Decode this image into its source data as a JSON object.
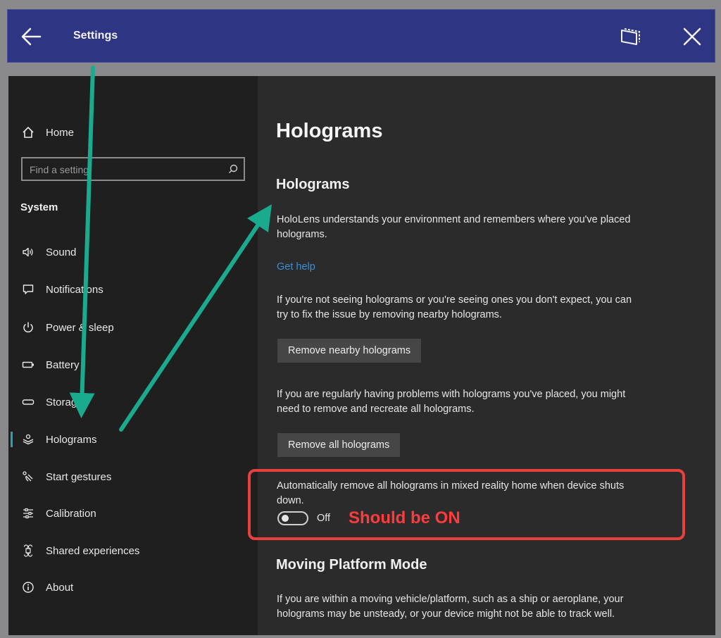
{
  "titlebar": {
    "title": "Settings",
    "back_icon": "arrow-left-icon",
    "snap_icon": "window-snap-icon",
    "close_icon": "close-icon"
  },
  "sidebar": {
    "home_label": "Home",
    "search": {
      "placeholder": "Find a setting"
    },
    "section_label": "System",
    "items": [
      {
        "label": "Sound",
        "icon": "speaker-icon"
      },
      {
        "label": "Notifications",
        "icon": "notification-icon"
      },
      {
        "label": "Power & sleep",
        "icon": "power-icon"
      },
      {
        "label": "Battery",
        "icon": "battery-icon"
      },
      {
        "label": "Storage",
        "icon": "storage-icon"
      },
      {
        "label": "Holograms",
        "icon": "holograms-icon",
        "selected": true
      },
      {
        "label": "Start gestures",
        "icon": "gesture-icon"
      },
      {
        "label": "Calibration",
        "icon": "sliders-icon"
      },
      {
        "label": "Shared experiences",
        "icon": "command-icon"
      },
      {
        "label": "About",
        "icon": "info-icon"
      }
    ],
    "accent_color": "#27a3b0"
  },
  "content": {
    "page_title": "Holograms",
    "section_title": "Holograms",
    "intro": "HoloLens understands your environment and remembers where you've placed holograms.",
    "help_link": "Get help",
    "nearby_desc": "If you're not seeing holograms or you're seeing ones you don't expect, you can try to fix the issue by removing nearby holograms.",
    "nearby_button": "Remove nearby holograms",
    "all_desc": "If you are regularly having problems with holograms you've placed, you might need to remove and recreate all holograms.",
    "all_button": "Remove all holograms",
    "auto_desc": "Automatically remove all holograms in mixed reality home when device shuts down.",
    "toggle_state": "Off",
    "moving_title": "Moving Platform Mode",
    "moving_desc": "If you are within a moving vehicle/platform, such as a ship or aeroplane, your holograms may be unsteady, or your device might not be able to track well."
  },
  "annotations": {
    "callout_text": "Should be ON",
    "arrow_color": "#1aab8e",
    "highlight_color": "#e8403e"
  }
}
